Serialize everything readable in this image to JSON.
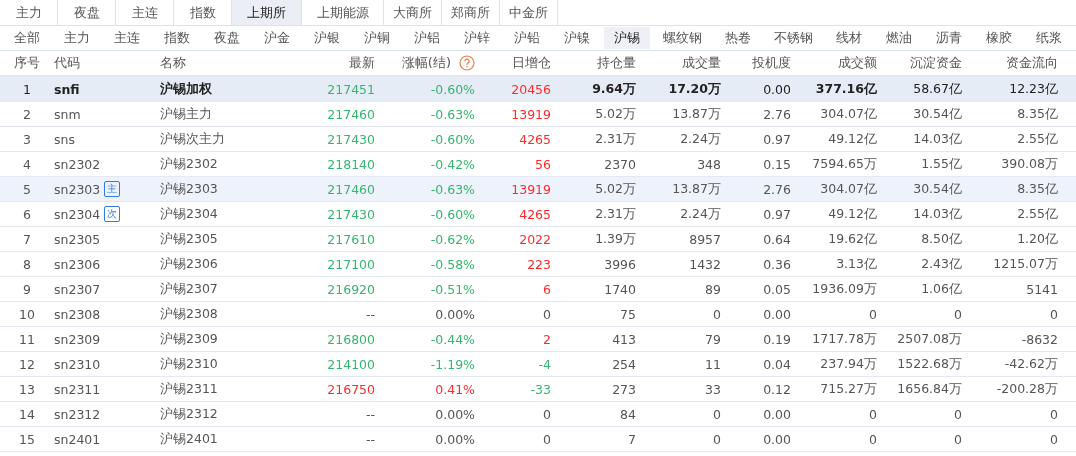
{
  "exchange_tabs": [
    {
      "label": "主力",
      "selected": false
    },
    {
      "label": "夜盘",
      "selected": false
    },
    {
      "label": "主连",
      "selected": false
    },
    {
      "label": "指数",
      "selected": false
    },
    {
      "label": "上期所",
      "selected": true
    },
    {
      "label": "上期能源",
      "selected": false
    },
    {
      "label": "大商所",
      "selected": false
    },
    {
      "label": "郑商所",
      "selected": false
    },
    {
      "label": "中金所",
      "selected": false
    }
  ],
  "product_tabs": [
    {
      "label": "全部",
      "selected": false
    },
    {
      "label": "主力",
      "selected": false
    },
    {
      "label": "主连",
      "selected": false
    },
    {
      "label": "指数",
      "selected": false
    },
    {
      "label": "夜盘",
      "selected": false
    },
    {
      "label": "沪金",
      "selected": false
    },
    {
      "label": "沪银",
      "selected": false
    },
    {
      "label": "沪铜",
      "selected": false
    },
    {
      "label": "沪铝",
      "selected": false
    },
    {
      "label": "沪锌",
      "selected": false
    },
    {
      "label": "沪铅",
      "selected": false
    },
    {
      "label": "沪镍",
      "selected": false
    },
    {
      "label": "沪锡",
      "selected": true
    },
    {
      "label": "螺纹钢",
      "selected": false
    },
    {
      "label": "热卷",
      "selected": false
    },
    {
      "label": "不锈钢",
      "selected": false
    },
    {
      "label": "线材",
      "selected": false
    },
    {
      "label": "燃油",
      "selected": false
    },
    {
      "label": "沥青",
      "selected": false
    },
    {
      "label": "橡胶",
      "selected": false
    },
    {
      "label": "纸浆",
      "selected": false
    }
  ],
  "table": {
    "columns": [
      "序号",
      "代码",
      "名称",
      "最新",
      "涨幅(结)",
      "日增仓",
      "持仓量",
      "成交量",
      "投机度",
      "成交额",
      "沉淀资金",
      "资金流向"
    ],
    "rows": [
      {
        "no": "1",
        "code": "snfi",
        "name": "沪锡加权",
        "last": {
          "text": "217451",
          "color": "#35b56f"
        },
        "change": {
          "text": "-0.60%",
          "color": "#35b56f"
        },
        "oi_change": {
          "text": "20456",
          "color": "#ff2a2a"
        },
        "oi": "9.64万",
        "volume": "17.20万",
        "spec": "0.00",
        "turnover": "377.16亿",
        "capital": "58.67亿",
        "flow": "12.23亿",
        "selected": true,
        "hovered": false
      },
      {
        "no": "2",
        "code": "snm",
        "name": "沪锡主力",
        "last": {
          "text": "217460",
          "color": "#35b56f"
        },
        "change": {
          "text": "-0.63%",
          "color": "#35b56f"
        },
        "oi_change": {
          "text": "13919",
          "color": "#ff2a2a"
        },
        "oi": "5.02万",
        "volume": "13.87万",
        "spec": "2.76",
        "turnover": "304.07亿",
        "capital": "30.54亿",
        "flow": "8.35亿",
        "selected": false,
        "hovered": false
      },
      {
        "no": "3",
        "code": "sns",
        "name": "沪锡次主力",
        "last": {
          "text": "217430",
          "color": "#35b56f"
        },
        "change": {
          "text": "-0.60%",
          "color": "#35b56f"
        },
        "oi_change": {
          "text": "4265",
          "color": "#ff2a2a"
        },
        "oi": "2.31万",
        "volume": "2.24万",
        "spec": "0.97",
        "turnover": "49.12亿",
        "capital": "14.03亿",
        "flow": "2.55亿",
        "selected": false,
        "hovered": false
      },
      {
        "no": "4",
        "code": "sn2302",
        "name": "沪锡2302",
        "last": {
          "text": "218140",
          "color": "#35b56f"
        },
        "change": {
          "text": "-0.42%",
          "color": "#35b56f"
        },
        "oi_change": {
          "text": "56",
          "color": "#ff2a2a"
        },
        "oi": "2370",
        "volume": "348",
        "spec": "0.15",
        "turnover": "7594.65万",
        "capital": "1.55亿",
        "flow": "390.08万",
        "selected": false,
        "hovered": false
      },
      {
        "no": "5",
        "code": "sn2303",
        "badge": "主",
        "name": "沪锡2303",
        "last": {
          "text": "217460",
          "color": "#35b56f"
        },
        "change": {
          "text": "-0.63%",
          "color": "#35b56f"
        },
        "oi_change": {
          "text": "13919",
          "color": "#ff2a2a"
        },
        "oi": "5.02万",
        "volume": "13.87万",
        "spec": "2.76",
        "turnover": "304.07亿",
        "capital": "30.54亿",
        "flow": "8.35亿",
        "selected": false,
        "hovered": true
      },
      {
        "no": "6",
        "code": "sn2304",
        "badge": "次",
        "name": "沪锡2304",
        "last": {
          "text": "217430",
          "color": "#35b56f"
        },
        "change": {
          "text": "-0.60%",
          "color": "#35b56f"
        },
        "oi_change": {
          "text": "4265",
          "color": "#ff2a2a"
        },
        "oi": "2.31万",
        "volume": "2.24万",
        "spec": "0.97",
        "turnover": "49.12亿",
        "capital": "14.03亿",
        "flow": "2.55亿",
        "selected": false,
        "hovered": false
      },
      {
        "no": "7",
        "code": "sn2305",
        "name": "沪锡2305",
        "last": {
          "text": "217610",
          "color": "#35b56f"
        },
        "change": {
          "text": "-0.62%",
          "color": "#35b56f"
        },
        "oi_change": {
          "text": "2022",
          "color": "#ff2a2a"
        },
        "oi": "1.39万",
        "volume": "8957",
        "spec": "0.64",
        "turnover": "19.62亿",
        "capital": "8.50亿",
        "flow": "1.20亿",
        "selected": false,
        "hovered": false
      },
      {
        "no": "8",
        "code": "sn2306",
        "name": "沪锡2306",
        "last": {
          "text": "217100",
          "color": "#35b56f"
        },
        "change": {
          "text": "-0.58%",
          "color": "#35b56f"
        },
        "oi_change": {
          "text": "223",
          "color": "#ff2a2a"
        },
        "oi": "3996",
        "volume": "1432",
        "spec": "0.36",
        "turnover": "3.13亿",
        "capital": "2.43亿",
        "flow": "1215.07万",
        "selected": false,
        "hovered": false
      },
      {
        "no": "9",
        "code": "sn2307",
        "name": "沪锡2307",
        "last": {
          "text": "216920",
          "color": "#35b56f"
        },
        "change": {
          "text": "-0.51%",
          "color": "#35b56f"
        },
        "oi_change": {
          "text": "6",
          "color": "#ff2a2a"
        },
        "oi": "1740",
        "volume": "89",
        "spec": "0.05",
        "turnover": "1936.09万",
        "capital": "1.06亿",
        "flow": "5141",
        "selected": false,
        "hovered": false
      },
      {
        "no": "10",
        "code": "sn2308",
        "name": "沪锡2308",
        "last": {
          "text": "--"
        },
        "change": {
          "text": "0.00%"
        },
        "oi_change": {
          "text": "0"
        },
        "oi": "75",
        "volume": "0",
        "spec": "0.00",
        "turnover": "0",
        "capital": "0",
        "flow": "0",
        "selected": false,
        "hovered": false
      },
      {
        "no": "11",
        "code": "sn2309",
        "name": "沪锡2309",
        "last": {
          "text": "216800",
          "color": "#35b56f"
        },
        "change": {
          "text": "-0.44%",
          "color": "#35b56f"
        },
        "oi_change": {
          "text": "2",
          "color": "#ff2a2a"
        },
        "oi": "413",
        "volume": "79",
        "spec": "0.19",
        "turnover": "1717.78万",
        "capital": "2507.08万",
        "flow": "-8632",
        "selected": false,
        "hovered": false
      },
      {
        "no": "12",
        "code": "sn2310",
        "name": "沪锡2310",
        "last": {
          "text": "214100",
          "color": "#35b56f"
        },
        "change": {
          "text": "-1.19%",
          "color": "#35b56f"
        },
        "oi_change": {
          "text": "-4",
          "color": "#35b56f"
        },
        "oi": "254",
        "volume": "11",
        "spec": "0.04",
        "turnover": "237.94万",
        "capital": "1522.68万",
        "flow": "-42.62万",
        "selected": false,
        "hovered": false
      },
      {
        "no": "13",
        "code": "sn2311",
        "name": "沪锡2311",
        "last": {
          "text": "216750",
          "color": "#ff2a2a"
        },
        "change": {
          "text": "0.41%",
          "color": "#ff2a2a"
        },
        "oi_change": {
          "text": "-33",
          "color": "#35b56f"
        },
        "oi": "273",
        "volume": "33",
        "spec": "0.12",
        "turnover": "715.27万",
        "capital": "1656.84万",
        "flow": "-200.28万",
        "selected": false,
        "hovered": false
      },
      {
        "no": "14",
        "code": "sn2312",
        "name": "沪锡2312",
        "last": {
          "text": "--"
        },
        "change": {
          "text": "0.00%"
        },
        "oi_change": {
          "text": "0"
        },
        "oi": "84",
        "volume": "0",
        "spec": "0.00",
        "turnover": "0",
        "capital": "0",
        "flow": "0",
        "selected": false,
        "hovered": false
      },
      {
        "no": "15",
        "code": "sn2401",
        "name": "沪锡2401",
        "last": {
          "text": "--"
        },
        "change": {
          "text": "0.00%"
        },
        "oi_change": {
          "text": "0"
        },
        "oi": "7",
        "volume": "0",
        "spec": "0.00",
        "turnover": "0",
        "capital": "0",
        "flow": "0",
        "selected": false,
        "hovered": false
      }
    ]
  }
}
